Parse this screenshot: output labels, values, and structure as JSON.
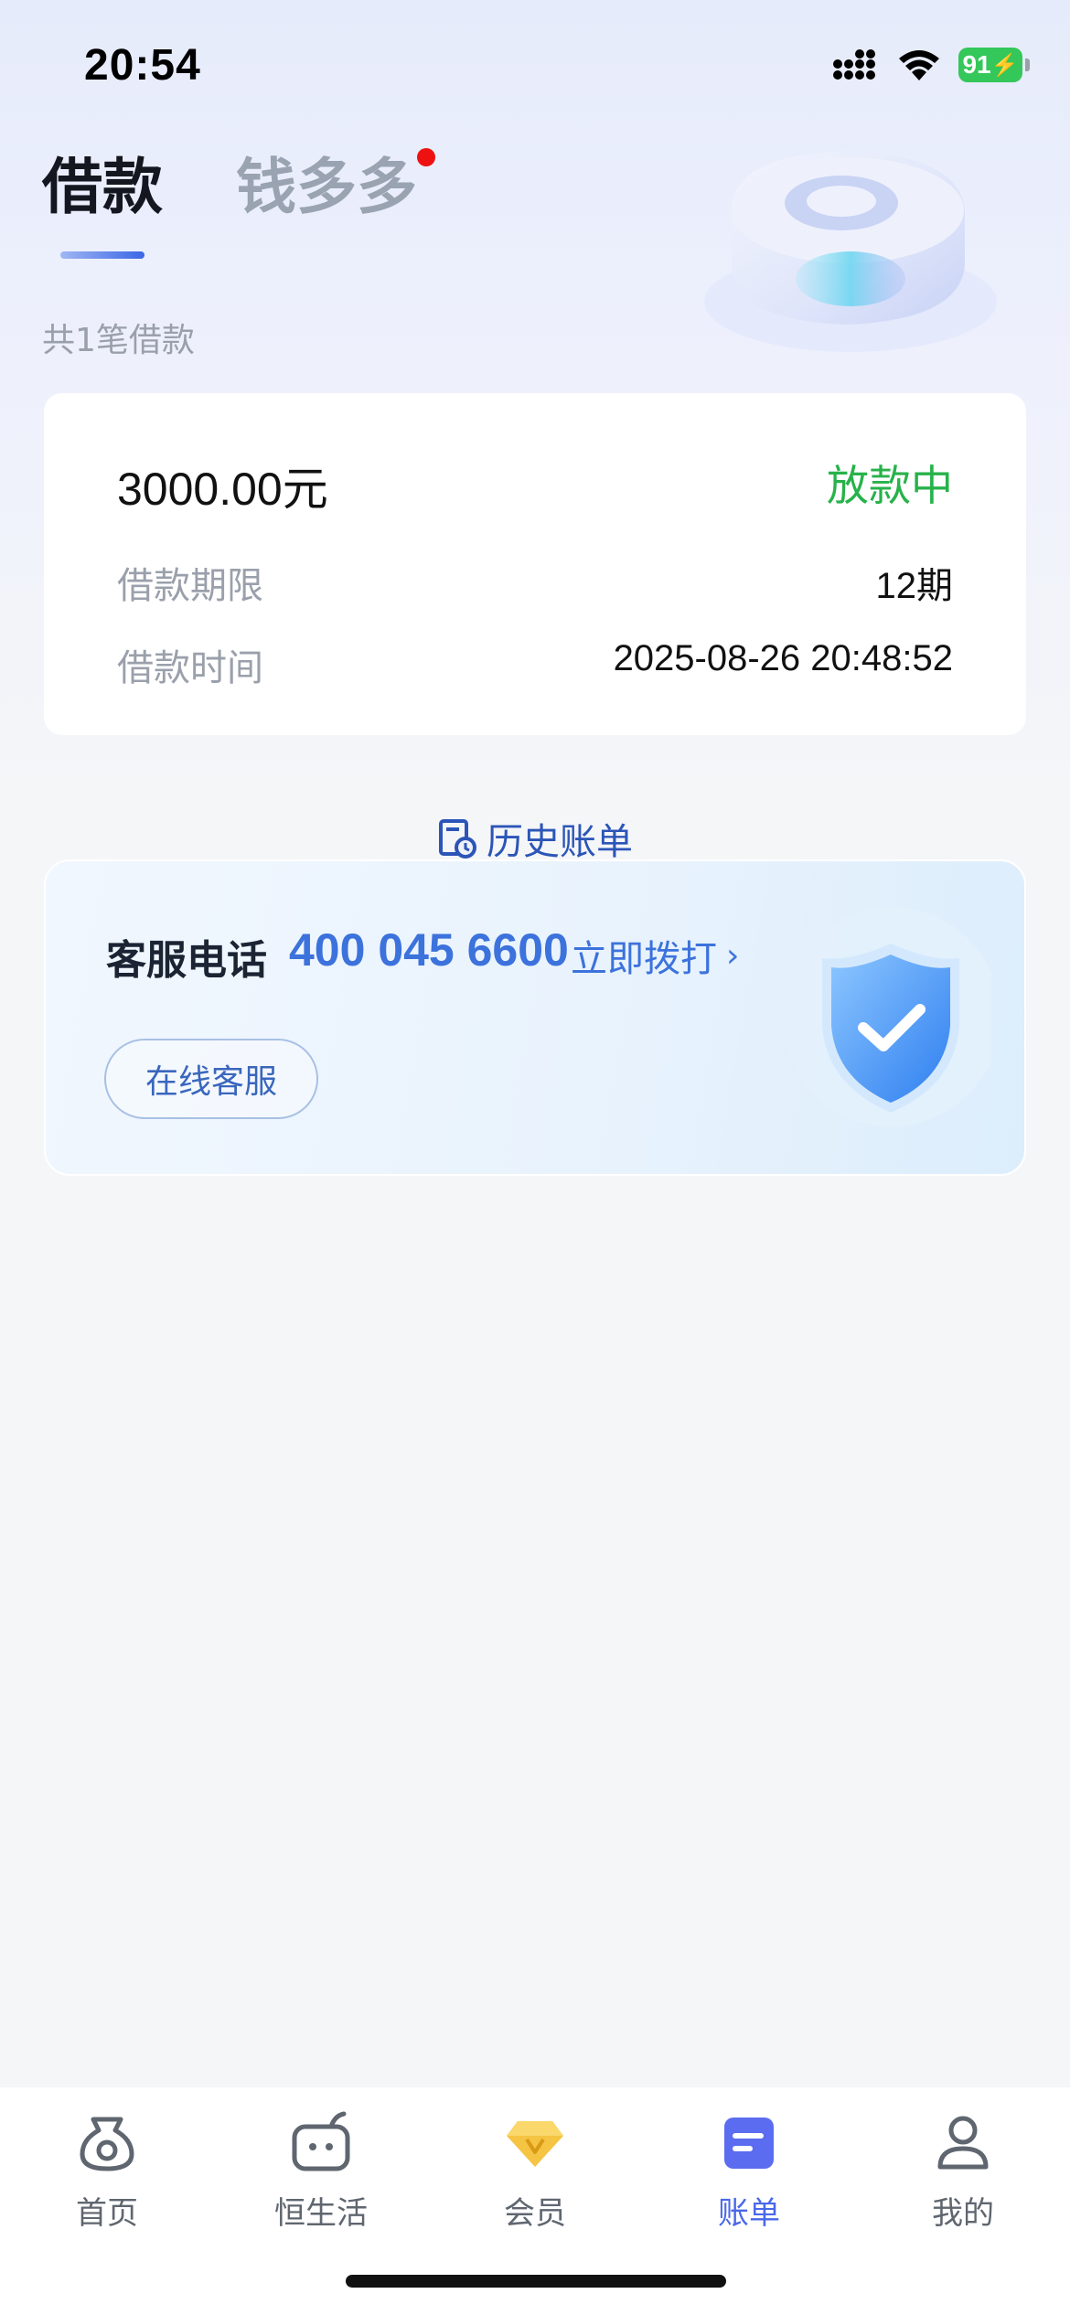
{
  "status_bar": {
    "time": "20:54",
    "battery": "91"
  },
  "tabs": [
    {
      "label": "借款",
      "active": true
    },
    {
      "label": "钱多多",
      "active": false,
      "has_badge_dot": true
    }
  ],
  "loan_summary": "共1笔借款",
  "loan": {
    "amount": "3000.00元",
    "status": "放款中",
    "term_label": "借款期限",
    "term_value": "12期",
    "time_label": "借款时间",
    "time_value": "2025-08-26 20:48:52"
  },
  "history": {
    "label": "历史账单"
  },
  "service": {
    "label": "客服电话",
    "phone": "400 045 6600",
    "call_label": "立即拨打",
    "online_label": "在线客服"
  },
  "bottom_nav": [
    {
      "label": "首页",
      "icon": "home-pouch-icon",
      "active": false
    },
    {
      "label": "恒生活",
      "icon": "life-face-icon",
      "active": false
    },
    {
      "label": "会员",
      "icon": "diamond-icon",
      "active": false
    },
    {
      "label": "账单",
      "icon": "bill-icon",
      "active": true
    },
    {
      "label": "我的",
      "icon": "user-icon",
      "active": false
    }
  ],
  "colors": {
    "accent": "#4a68e8",
    "status_green": "#27b24a",
    "phone_blue": "#3c72dc"
  }
}
